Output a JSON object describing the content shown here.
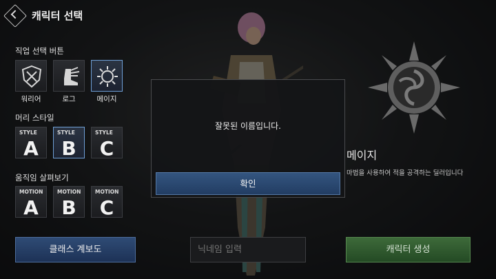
{
  "header": {
    "title": "캐릭터 선택",
    "back_icon": "back-arrow-icon"
  },
  "class_section": {
    "label": "직업 선택 버튼",
    "items": [
      {
        "label": "워리어",
        "icon": "shield-icon",
        "selected": false
      },
      {
        "label": "로그",
        "icon": "winged-boot-icon",
        "selected": false
      },
      {
        "label": "메이지",
        "icon": "sun-emblem-icon",
        "selected": true
      }
    ]
  },
  "hair_section": {
    "label": "머리 스타일",
    "items": [
      {
        "tag": "STYLE",
        "letter": "A",
        "selected": false
      },
      {
        "tag": "STYLE",
        "letter": "B",
        "selected": true
      },
      {
        "tag": "STYLE",
        "letter": "C",
        "selected": false
      }
    ]
  },
  "motion_section": {
    "label": "움직임 살펴보기",
    "items": [
      {
        "tag": "MOTION",
        "letter": "A"
      },
      {
        "tag": "MOTION",
        "letter": "B"
      },
      {
        "tag": "MOTION",
        "letter": "C"
      }
    ]
  },
  "info": {
    "class_name": "메이지",
    "description": "마법을 사용하여 적을 공격하는 딜러입니다",
    "emblem_icon": "sun-emblem-icon"
  },
  "bottom": {
    "class_tree_label": "클래스 계보도",
    "nickname_placeholder": "닉네임 입력",
    "create_label": "캐릭터 생성"
  },
  "modal": {
    "message": "잘못된 이름입니다.",
    "ok_label": "확인"
  },
  "colors": {
    "accent_blue": "#2f4b75",
    "create_green": "#3d6a3a",
    "selected_border": "#6fa0d8"
  }
}
